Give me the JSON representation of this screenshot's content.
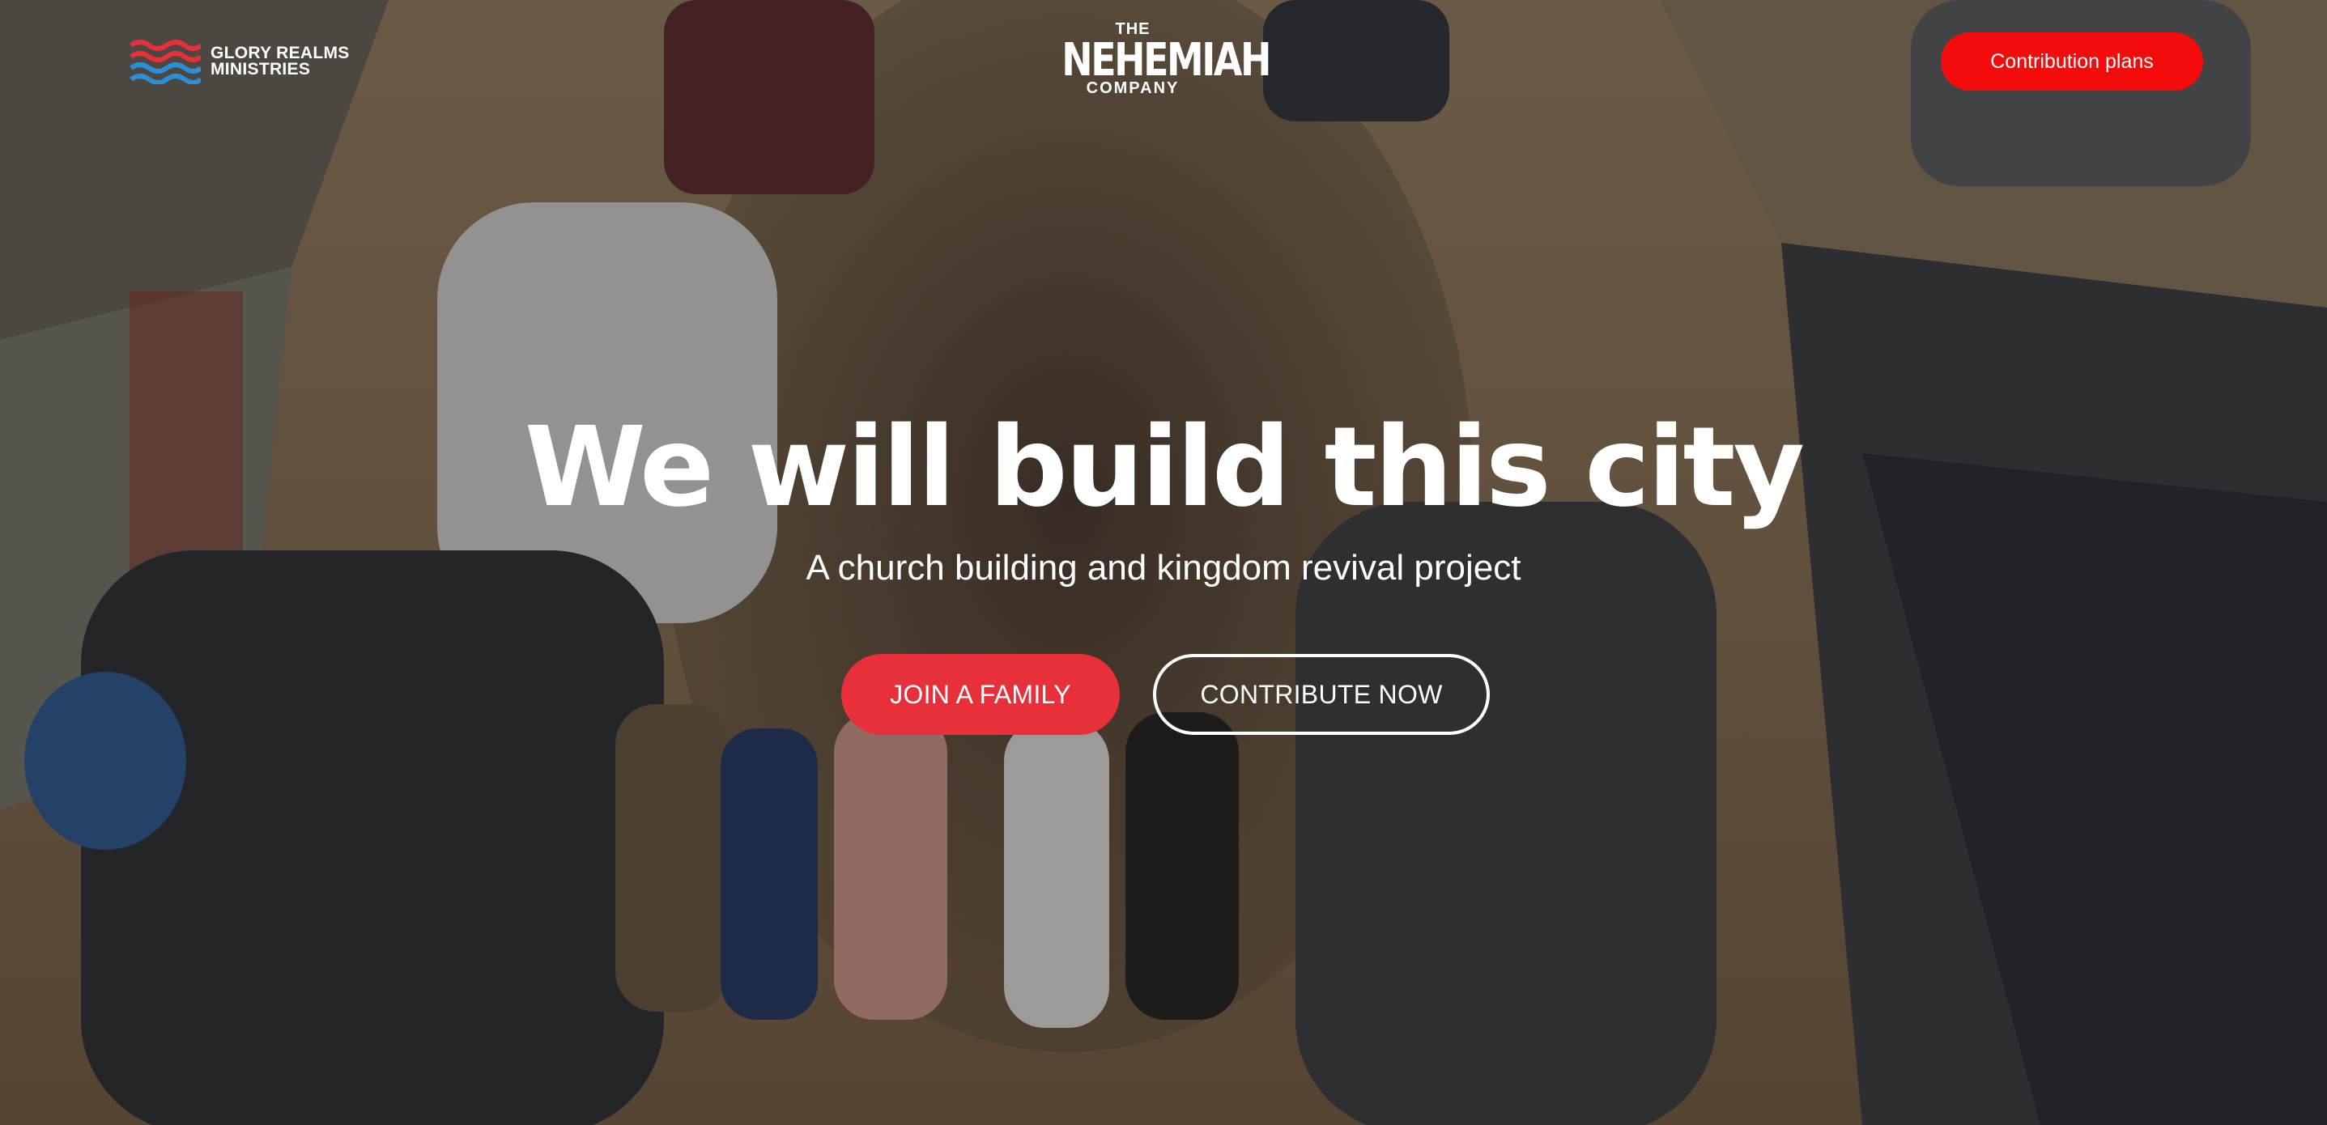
{
  "brand": {
    "line1": "GLORY REALMS",
    "line2": "MINISTRIES",
    "icon": "wave-lines-logo",
    "colors": [
      "#e8303a",
      "#2a8fd8"
    ]
  },
  "project_logo": {
    "top": "THE",
    "main": "NEHEMIAH",
    "bottom": "COMPANY"
  },
  "nav": {
    "contribution_plans": "Contribution plans"
  },
  "hero": {
    "headline": "We will build this city",
    "subheadline": "A church building and kingdom revival project",
    "join_label": "JOIN A FAMILY",
    "contribute_label": "CONTRIBUTE NOW"
  },
  "colors": {
    "accent": "#e8303a",
    "nav_button": "#f40c0c"
  }
}
